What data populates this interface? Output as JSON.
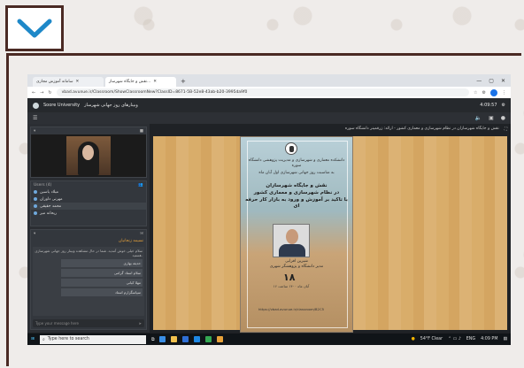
{
  "browser": {
    "tabs": [
      {
        "label": "سامانه آموزش مجازی"
      },
      {
        "label": "نقش و جایگاه شهرساز..."
      }
    ],
    "url": "vbad.avunue.ir/Classroom/ShowClassroomNew?ClassID=8671-5B-52e8-43ab-b20-3995da9f0",
    "window_controls": [
      "—",
      "▢",
      "✕"
    ]
  },
  "app": {
    "org": "Soore University",
    "room_name": "وبینارهای روز جهانی شهرساز",
    "time": "4:09:57"
  },
  "stage": {
    "title": "نقش و جایگاه شهرسازان در نظام شهرسازی و معماری کشور - ارائه: زرقمینر دانشگاه سوره"
  },
  "left": {
    "users_header": "Users (4)",
    "users": [
      "میلاد یاسین",
      "مهرنی داوران",
      "محمد حقیقی",
      "ریحانه میر"
    ],
    "chat_title": "نسیمه زنجانیان",
    "chat_intro": "سلام خیلی خوش آمدید. شما در حال مشاهده وبینار روز جهانی شهرسازی هستید.",
    "messages": [
      "حدیثه بهاری",
      "سلام استاد گرامی",
      "مهلا کیانی",
      "سپاسگزارم استاد"
    ],
    "chat_placeholder": "Type your message here"
  },
  "poster": {
    "university": "دانشکده معماری و شهرسازی و مدیریت پژوهشی دانشگاه سوره",
    "event": "به مناسبت روز جهانی شهرسازی اول آبان ماه",
    "title_1": "نقش و جایگاه شهرسازان",
    "title_2": "در نظام شهرسازی و معماری کشور",
    "title_3": "با تاکید بر آموزش و ورود به بازار کار حرفه ای",
    "speaker": "شیرین افزایی",
    "speaker_role": "مدیر دانشگاه و پژوهشگر شهری",
    "date_number": "۱۸",
    "date_text": "آبان ماه ۱۴۰۰ ساعت ۱۶",
    "link": "https://vbad.avunue.ir/classroom/B2C5"
  },
  "taskbar": {
    "search_placeholder": "Type here to search",
    "weather": "54°F Clear",
    "language": "ENG",
    "clock": "4:09 PM"
  }
}
